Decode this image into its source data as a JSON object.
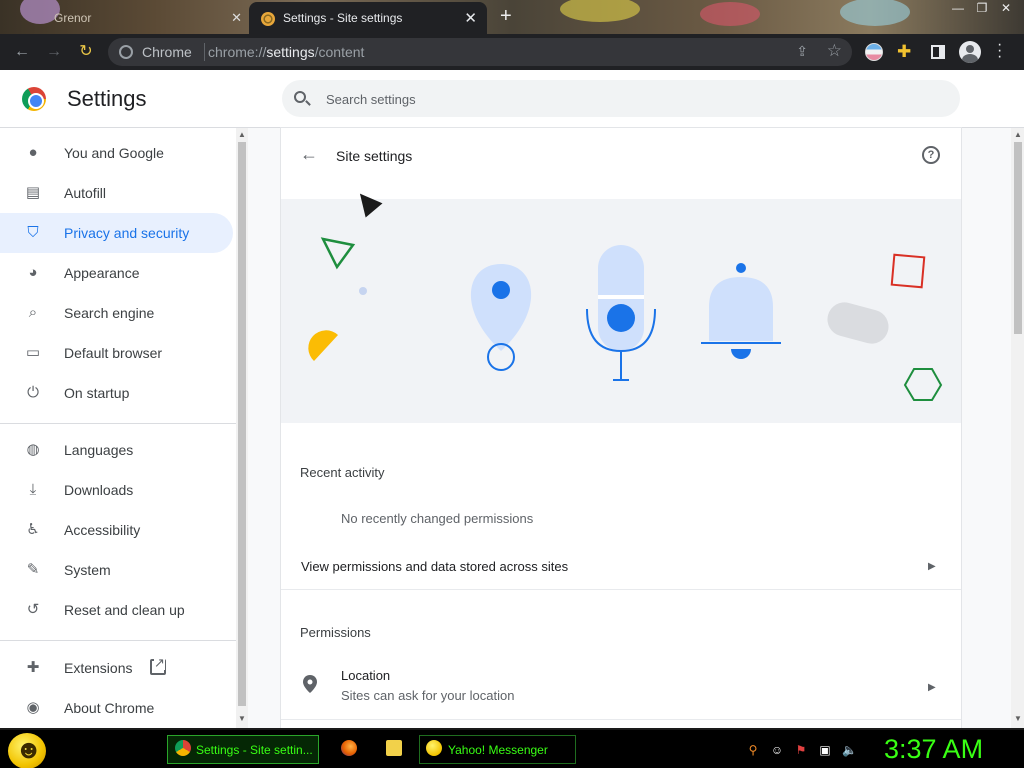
{
  "browser": {
    "inactive_tab_label": "Grenor",
    "active_tab_label": "Settings - Site settings",
    "omnibox_chip": "Chrome",
    "url_prefix": "chrome://",
    "url_host": "settings",
    "url_path": "/content"
  },
  "settings": {
    "title": "Settings",
    "search_placeholder": "Search settings"
  },
  "sidebar": {
    "items": [
      {
        "label": "You and Google",
        "icon": "person-icon"
      },
      {
        "label": "Autofill",
        "icon": "clipboard-icon"
      },
      {
        "label": "Privacy and security",
        "icon": "shield-icon",
        "active": true
      },
      {
        "label": "Appearance",
        "icon": "palette-icon"
      },
      {
        "label": "Search engine",
        "icon": "search-icon"
      },
      {
        "label": "Default browser",
        "icon": "browser-icon"
      },
      {
        "label": "On startup",
        "icon": "power-icon"
      },
      {
        "label": "Languages",
        "icon": "globe-icon"
      },
      {
        "label": "Downloads",
        "icon": "download-icon"
      },
      {
        "label": "Accessibility",
        "icon": "accessibility-icon"
      },
      {
        "label": "System",
        "icon": "wrench-icon"
      },
      {
        "label": "Reset and clean up",
        "icon": "restore-icon"
      },
      {
        "label": "Extensions",
        "icon": "puzzle-icon"
      },
      {
        "label": "About Chrome",
        "icon": "chrome-icon"
      }
    ]
  },
  "site_settings": {
    "title": "Site settings",
    "recent_activity_label": "Recent activity",
    "no_recent": "No recently changed permissions",
    "view_permissions": "View permissions and data stored across sites",
    "permissions_label": "Permissions",
    "location_title": "Location",
    "location_sub": "Sites can ask for your location"
  },
  "taskbar": {
    "chrome_task": "Settings - Site settin...",
    "yahoo_task": "Yahoo! Messenger",
    "clock": "3:37 AM"
  },
  "colors": {
    "accent": "#1a73e8",
    "active_nav_bg": "#e8f0fe",
    "taskbar_text": "#39ff14"
  }
}
